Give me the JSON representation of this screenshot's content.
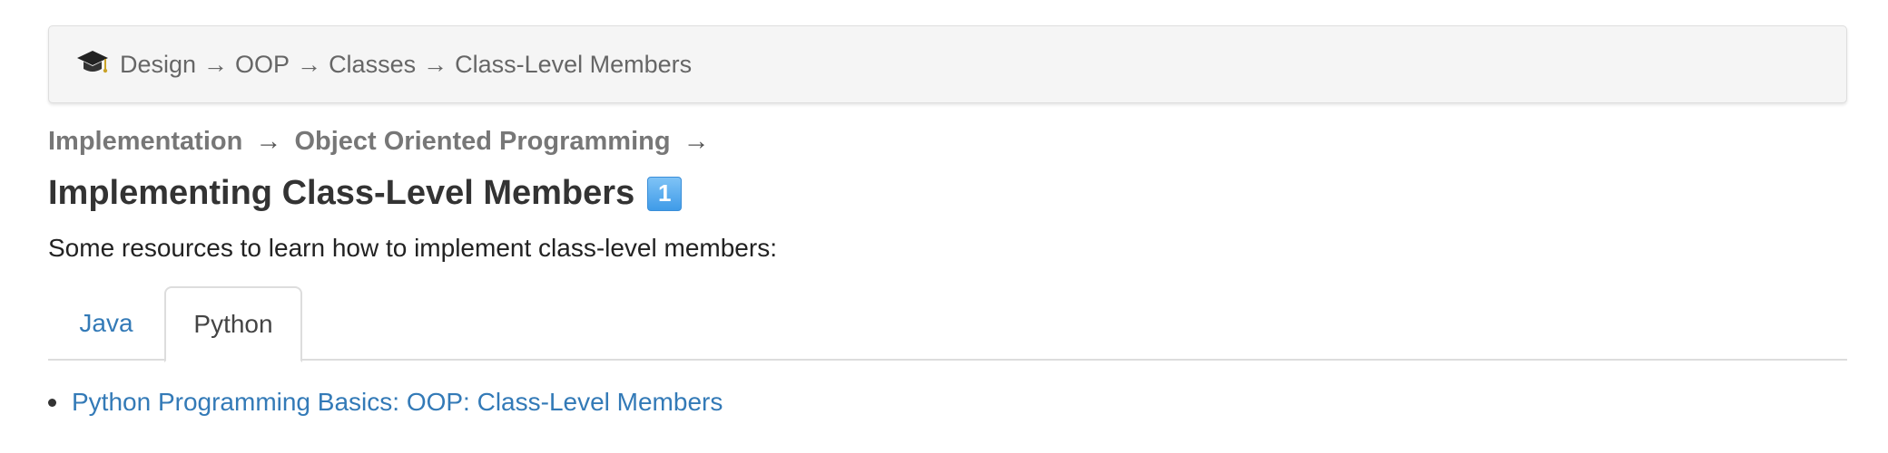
{
  "breadcrumb": {
    "icon": "graduation-cap-icon",
    "items": [
      "Design",
      "OOP",
      "Classes",
      "Class-Level Members"
    ],
    "separator": "→"
  },
  "subtrail": {
    "items": [
      "Implementation",
      "Object Oriented Programming"
    ],
    "separator": "→"
  },
  "page": {
    "title": "Implementing Class-Level Members",
    "level_badge": "1",
    "intro": "Some resources to learn how to implement class-level members:"
  },
  "tabs": [
    {
      "label": "Java",
      "active": false
    },
    {
      "label": "Python",
      "active": true
    }
  ],
  "resources": [
    {
      "label": "Python Programming Basics: OOP: Class-Level Members"
    }
  ],
  "colors": {
    "link": "#337ab7",
    "breadcrumb_bg": "#f5f5f5",
    "badge": "#3f9be8"
  }
}
